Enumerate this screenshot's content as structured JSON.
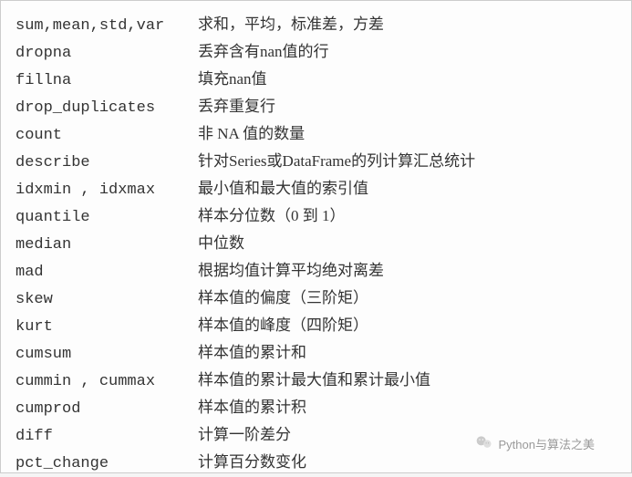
{
  "rows": [
    {
      "func": "sum,mean,std,var",
      "desc": "求和，平均，标准差，方差"
    },
    {
      "func": "dropna",
      "desc": "丢弃含有nan值的行"
    },
    {
      "func": "fillna",
      "desc": "填充nan值"
    },
    {
      "func": "drop_duplicates",
      "desc": "丢弃重复行"
    },
    {
      "func": "count",
      "desc": "非 NA 值的数量"
    },
    {
      "func": "describe",
      "desc": "针对Series或DataFrame的列计算汇总统计"
    },
    {
      "func": "idxmin , idxmax",
      "desc": "最小值和最大值的索引值"
    },
    {
      "func": "quantile",
      "desc": "样本分位数（0 到 1）"
    },
    {
      "func": "median",
      "desc": "中位数"
    },
    {
      "func": "mad",
      "desc": "根据均值计算平均绝对离差"
    },
    {
      "func": "skew",
      "desc": "样本值的偏度（三阶矩）"
    },
    {
      "func": "kurt",
      "desc": "样本值的峰度（四阶矩）"
    },
    {
      "func": "cumsum",
      "desc": "样本值的累计和"
    },
    {
      "func": "cummin , cummax",
      "desc": "样本值的累计最大值和累计最小值"
    },
    {
      "func": "cumprod",
      "desc": "样本值的累计积"
    },
    {
      "func": "diff",
      "desc": "计算一阶差分"
    },
    {
      "func": "pct_change",
      "desc": "计算百分数变化"
    }
  ],
  "watermark": {
    "text": "Python与算法之美"
  }
}
